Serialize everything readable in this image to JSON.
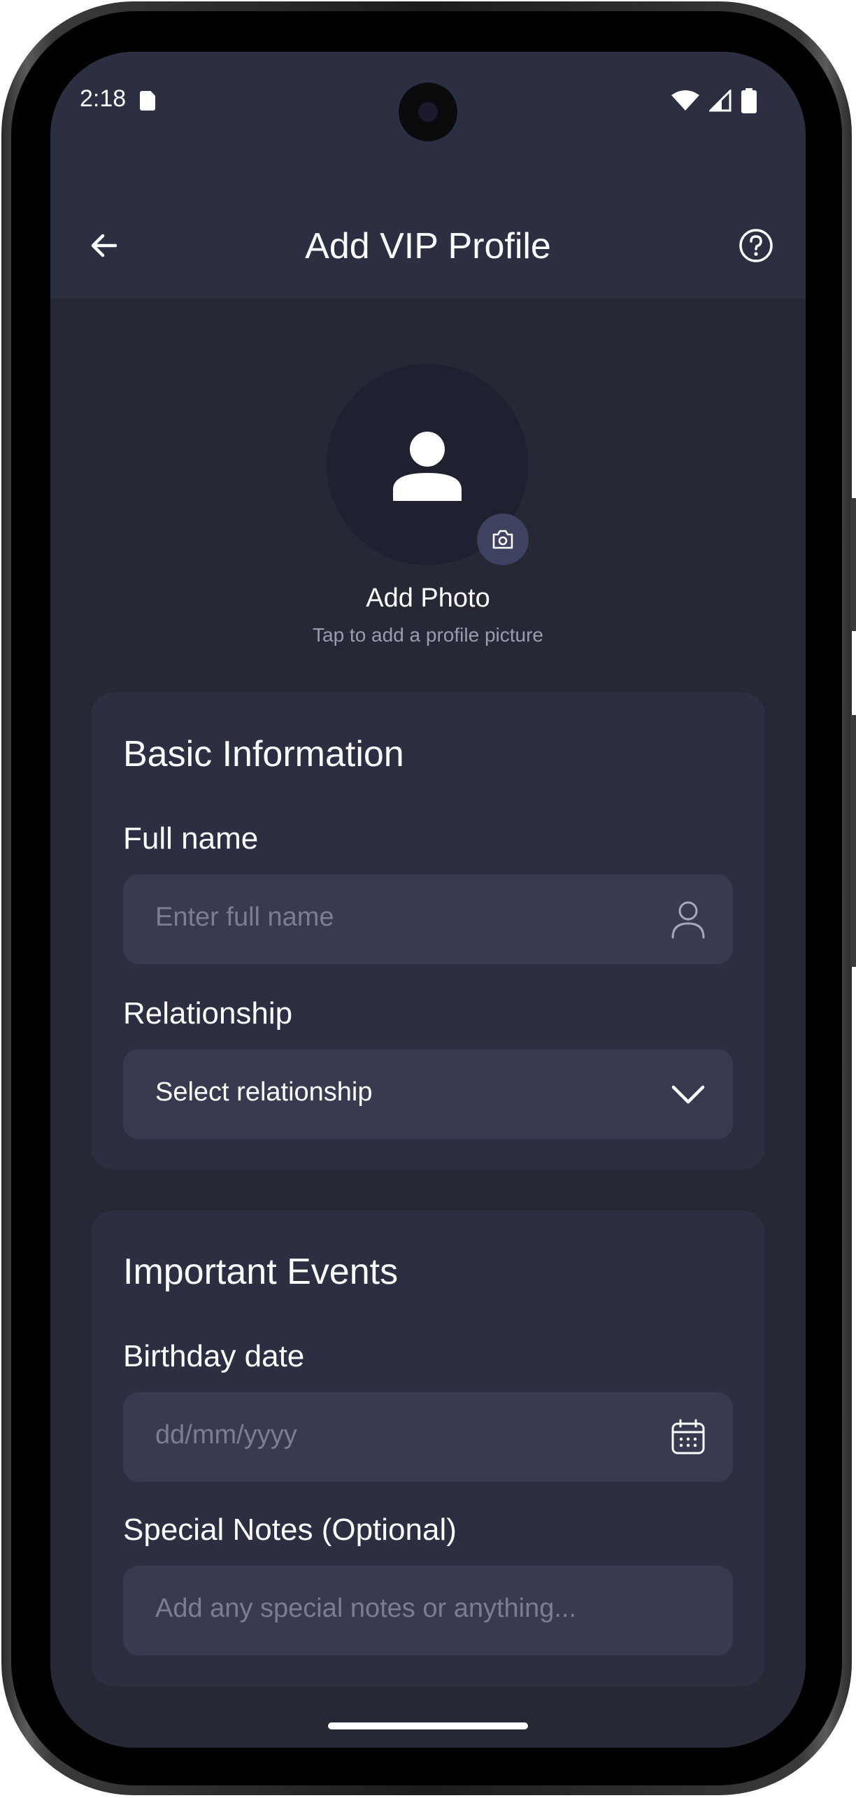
{
  "status_bar": {
    "time": "2:18"
  },
  "app_bar": {
    "title": "Add VIP Profile",
    "back_icon": "arrow-back-icon",
    "help_icon": "help-circle-icon"
  },
  "photo": {
    "label": "Add Photo",
    "hint": "Tap to add a profile picture",
    "avatar_icon": "person-icon",
    "badge_icon": "camera-icon"
  },
  "basic_info": {
    "title": "Basic Information",
    "full_name": {
      "label": "Full name",
      "placeholder": "Enter full name",
      "icon": "person-outline-icon"
    },
    "relationship": {
      "label": "Relationship",
      "value": "Select relationship",
      "icon": "chevron-down-icon"
    }
  },
  "events": {
    "title": "Important Events",
    "birthday": {
      "label": "Birthday date",
      "placeholder": "dd/mm/yyyy",
      "icon": "calendar-icon"
    },
    "notes": {
      "label": "Special Notes (Optional)",
      "placeholder": "Add any special notes or anything..."
    }
  },
  "colors": {
    "background": "#262836",
    "surface": "#2c2f42",
    "field": "#383b4f",
    "avatar_bg": "#1f2130",
    "badge": "#3d4260",
    "text_primary": "#ffffff",
    "text_hint": "#7b7e92"
  }
}
